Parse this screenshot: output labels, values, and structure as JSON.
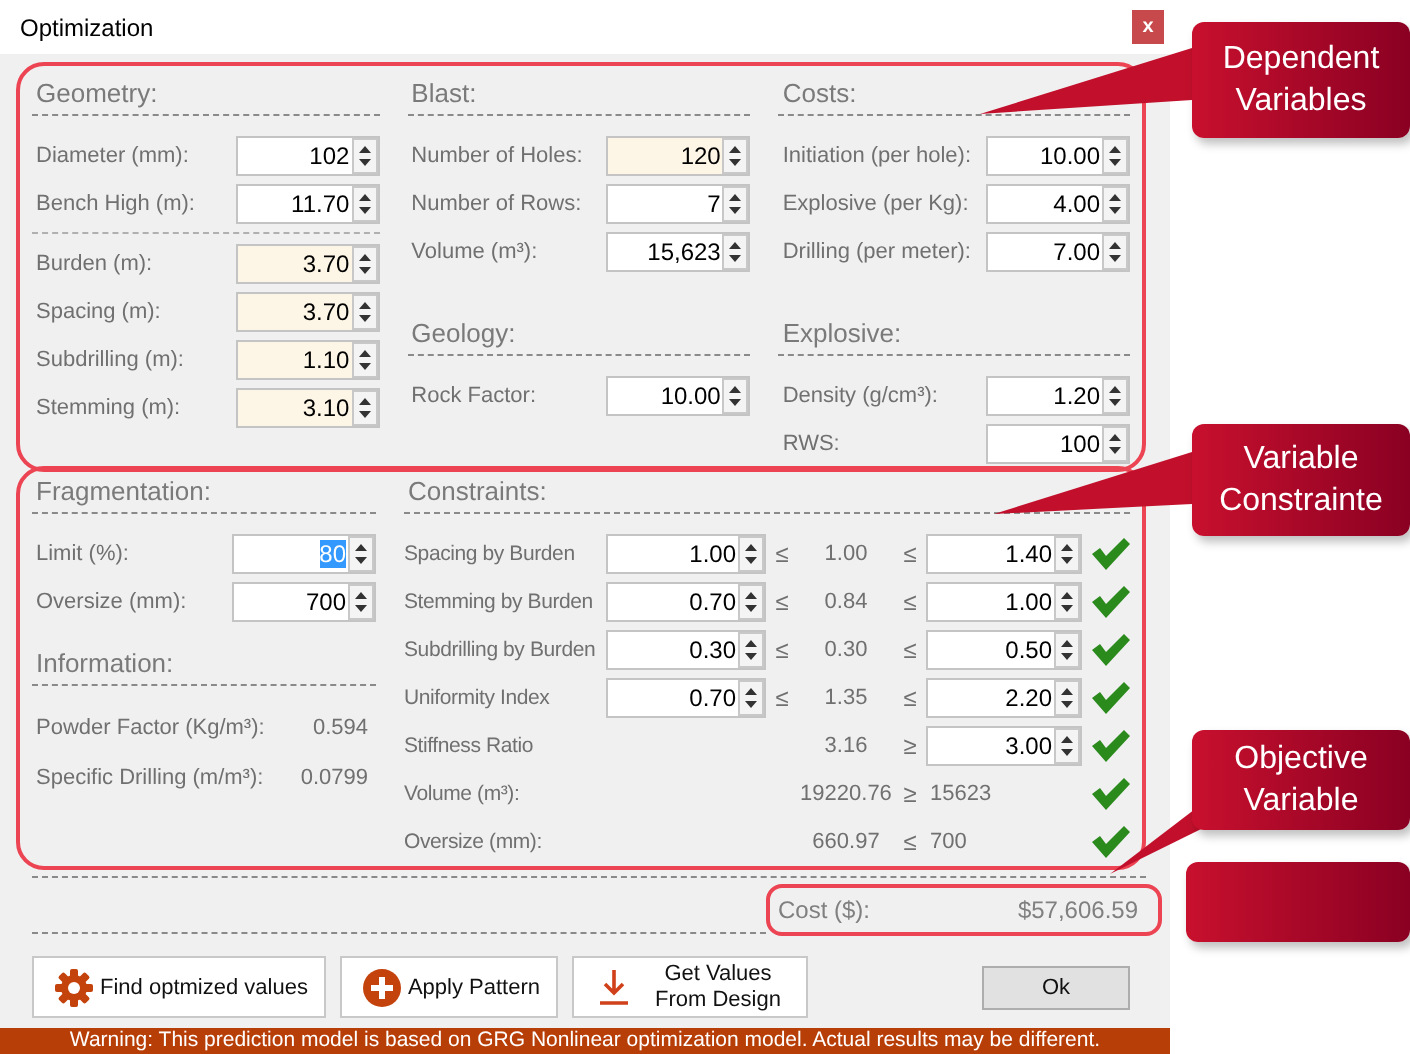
{
  "window": {
    "title": "Optimization",
    "close": "x"
  },
  "dependent_panel": {
    "columns": [
      {
        "sections": [
          {
            "title": "Geometry:",
            "rows": [
              {
                "kind": "field",
                "label": "Diameter (mm):",
                "value": "102",
                "highlighted": false
              },
              {
                "kind": "field",
                "label": "Bench High (m):",
                "value": "11.70",
                "highlighted": false
              },
              {
                "kind": "divider"
              },
              {
                "kind": "field",
                "label": "Burden (m):",
                "value": "3.70",
                "highlighted": true
              },
              {
                "kind": "field",
                "label": "Spacing  (m):",
                "value": "3.70",
                "highlighted": true
              },
              {
                "kind": "field",
                "label": "Subdrilling (m):",
                "value": "1.10",
                "highlighted": true
              },
              {
                "kind": "field",
                "label": "Stemming (m):",
                "value": "3.10",
                "highlighted": true
              }
            ]
          }
        ]
      },
      {
        "sections": [
          {
            "title": "Blast:",
            "rows": [
              {
                "kind": "field",
                "label": "Number of Holes:",
                "value": "120",
                "highlighted": true
              },
              {
                "kind": "field",
                "label": "Number of Rows:",
                "value": "7",
                "highlighted": false
              },
              {
                "kind": "field",
                "label": "Volume (m³):",
                "value": "15,623",
                "highlighted": false
              }
            ]
          },
          {
            "title": "Geology:",
            "rows": [
              {
                "kind": "field",
                "label": "Rock Factor:",
                "value": "10.00",
                "highlighted": false
              }
            ]
          }
        ]
      },
      {
        "sections": [
          {
            "title": "Costs:",
            "rows": [
              {
                "kind": "field",
                "label": "Initiation (per hole):",
                "value": "10.00",
                "highlighted": false
              },
              {
                "kind": "field",
                "label": "Explosive (per Kg):",
                "value": "4.00",
                "highlighted": false
              },
              {
                "kind": "field",
                "label": "Drilling (per meter):",
                "value": "7.00",
                "highlighted": false
              }
            ]
          },
          {
            "title": "Explosive:",
            "rows": [
              {
                "kind": "field",
                "label": "Density (g/cm³):",
                "value": "1.20",
                "highlighted": false
              },
              {
                "kind": "field",
                "label": "RWS:",
                "value": "100",
                "highlighted": false
              }
            ]
          }
        ]
      }
    ]
  },
  "constraint_panel": {
    "sections": [
      {
        "title": "Fragmentation:",
        "rows": [
          {
            "kind": "field",
            "label": "Limit (%):",
            "value": "80",
            "highlighted": false,
            "text_selected": true
          },
          {
            "kind": "field",
            "label": "Oversize (mm):",
            "value": "700",
            "highlighted": false,
            "text_selected": false
          }
        ]
      },
      {
        "title": "Information:",
        "rows": [
          {
            "kind": "info",
            "label": "Powder Factor (Kg/m³):",
            "value": "0.594"
          },
          {
            "kind": "info",
            "label": "Specific Drilling (m/m³):",
            "value": "0.0799"
          }
        ]
      }
    ],
    "constraints": {
      "title": "Constraints:",
      "rows": [
        {
          "label": "Spacing by Burden",
          "lower_field": "1.00",
          "op_lower": "≤",
          "current": "1.00",
          "op_upper": "≤",
          "upper_field": "1.40",
          "satisfied": true
        },
        {
          "label": "Stemming by Burden",
          "lower_field": "0.70",
          "op_lower": "≤",
          "current": "0.84",
          "op_upper": "≤",
          "upper_field": "1.00",
          "satisfied": true
        },
        {
          "label": "Subdrilling by Burden",
          "lower_field": "0.30",
          "op_lower": "≤",
          "current": "0.30",
          "op_upper": "≤",
          "upper_field": "0.50",
          "satisfied": true
        },
        {
          "label": "Uniformity Index",
          "lower_field": "0.70",
          "op_lower": "≤",
          "current": "1.35",
          "op_upper": "≤",
          "upper_field": "2.20",
          "satisfied": true
        },
        {
          "label": "Stiffness Ratio",
          "current": "3.16",
          "op_upper": "≥",
          "upper_field": "3.00",
          "satisfied": true
        },
        {
          "label": "Volume (m³):",
          "current": "19220.76",
          "op_upper": "≥",
          "upper_text": "15623",
          "satisfied": true
        },
        {
          "label": "Oversize (mm):",
          "current": "660.97",
          "op_upper": "≤",
          "upper_text": "700",
          "satisfied": true
        }
      ]
    }
  },
  "cost": {
    "label": "Cost ($):",
    "value": "$57,606.59"
  },
  "buttons": [
    {
      "kind": "gear",
      "label": "Find optmized values"
    },
    {
      "kind": "plus",
      "label": "Apply Pattern"
    },
    {
      "kind": "download",
      "label": "Get Values From Design"
    }
  ],
  "ok_button": "Ok",
  "warning": "Warning: This prediction model is based on GRG Nonlinear optimization model. Actual results may be different.",
  "callouts": [
    {
      "text": "Dependent Variables",
      "kind": "top"
    },
    {
      "text": "Variable Constrainte",
      "kind": "middle"
    },
    {
      "text": "Objective Variable",
      "kind": "lower"
    },
    {
      "kind": "bottom"
    }
  ]
}
